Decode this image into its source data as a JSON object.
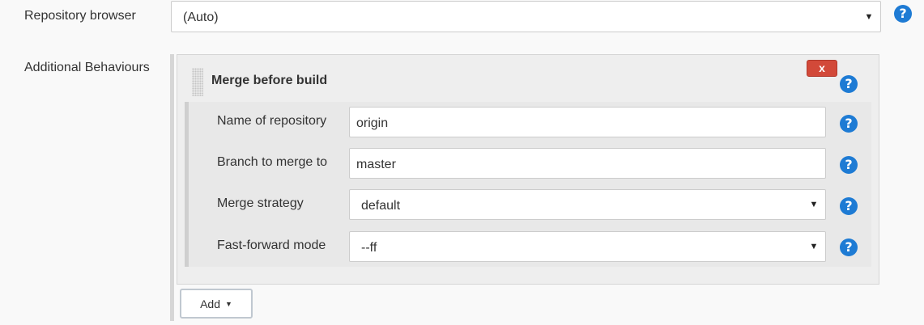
{
  "repository_browser": {
    "label": "Repository browser",
    "value": "(Auto)",
    "help": "?"
  },
  "additional_behaviours": {
    "label": "Additional Behaviours",
    "merge_before_build": {
      "title": "Merge before build",
      "delete_label": "x",
      "help": "?",
      "fields": [
        {
          "label": "Name of repository",
          "value": "origin",
          "help": "?"
        },
        {
          "label": "Branch to merge to",
          "value": "master",
          "help": "?"
        },
        {
          "label": "Merge strategy",
          "value": "default",
          "help": "?"
        },
        {
          "label": "Fast-forward mode",
          "value": "--ff",
          "help": "?"
        }
      ]
    },
    "add_button": {
      "label": "Add",
      "caret": "▼"
    }
  },
  "icons": {
    "dropdown_arrow": "▼",
    "help_icon_color": "#1e7bd4",
    "delete_button_color": "#d24939"
  }
}
